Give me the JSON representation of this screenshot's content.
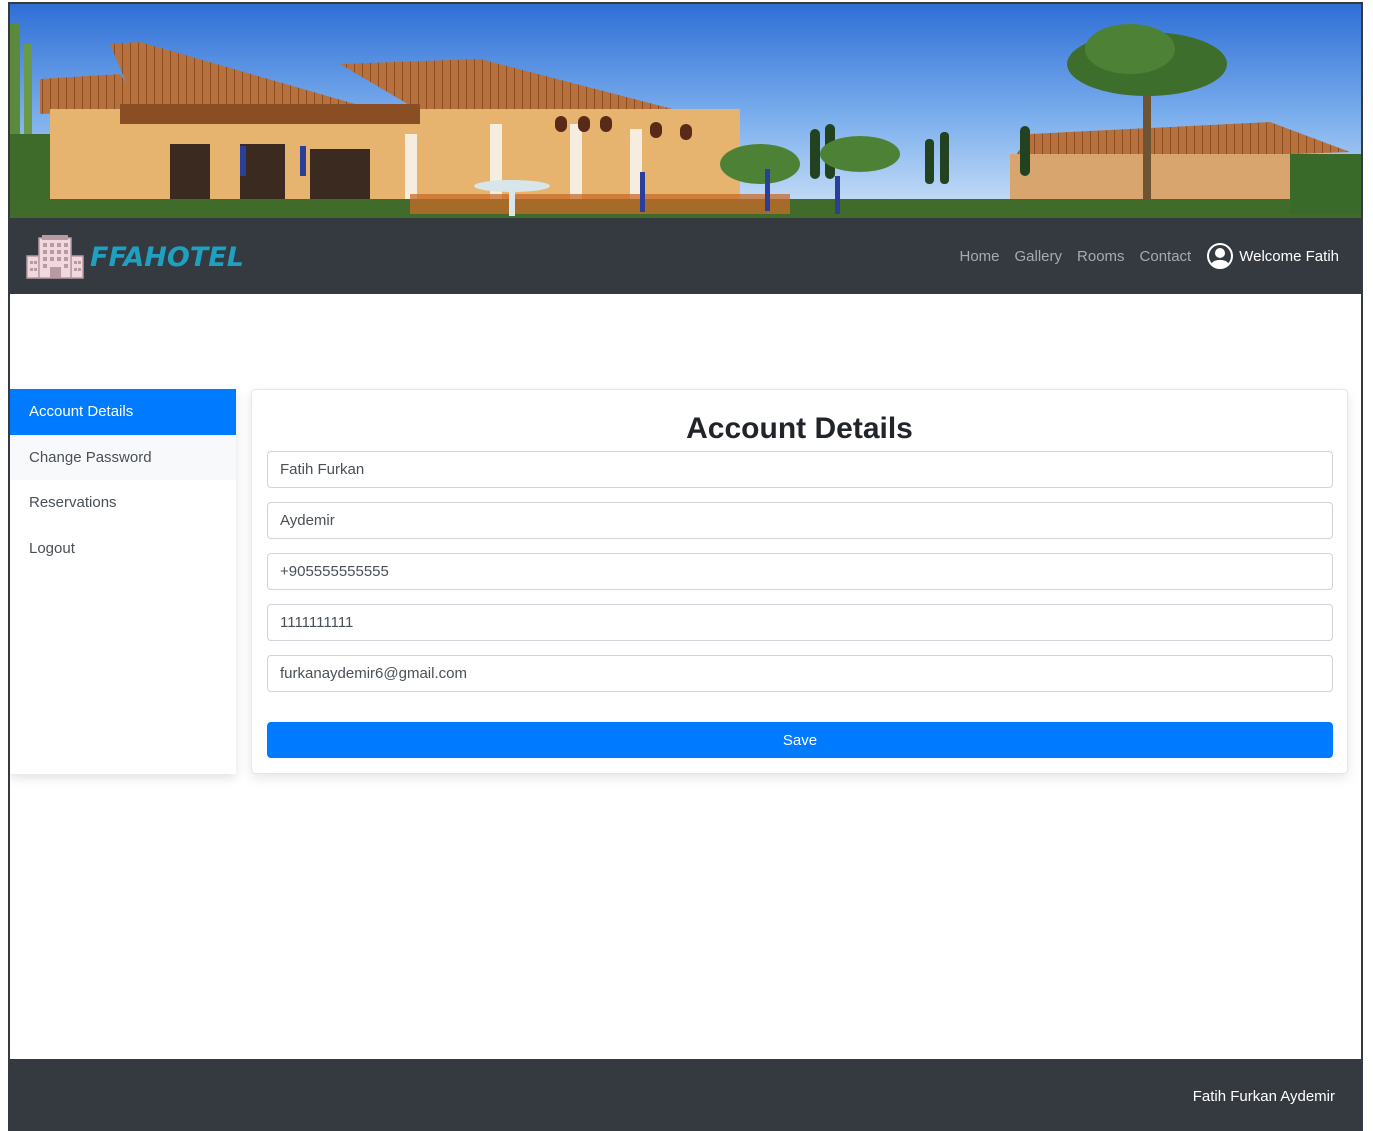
{
  "navbar": {
    "brand": "FFAHOTEL",
    "links": [
      "Home",
      "Gallery",
      "Rooms",
      "Contact"
    ],
    "welcome": "Welcome Fatih"
  },
  "sidebar": {
    "items": [
      {
        "label": "Account Details",
        "active": true
      },
      {
        "label": "Change Password",
        "active": false
      },
      {
        "label": "Reservations",
        "active": false
      },
      {
        "label": "Logout",
        "active": false
      }
    ]
  },
  "form": {
    "title": "Account Details",
    "first_name": "Fatih Furkan",
    "last_name": "Aydemir",
    "phone": "+905555555555",
    "identity_number": "1111111111",
    "email": "furkanaydemir6@gmail.com",
    "save_label": "Save"
  },
  "footer": {
    "text": "Fatih Furkan Aydemir"
  },
  "colors": {
    "navbar_bg": "#343a40",
    "primary": "#007bff",
    "brand": "#1fa0c0"
  }
}
